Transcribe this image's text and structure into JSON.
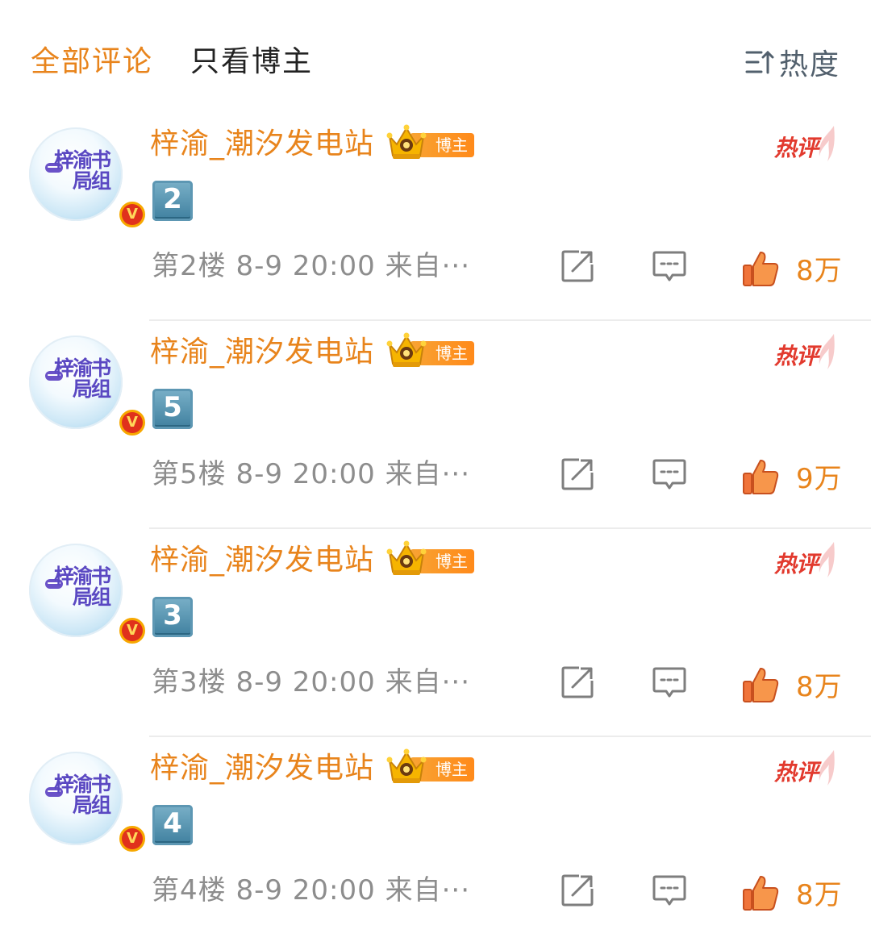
{
  "tabs": {
    "all": "全部评论",
    "blogger_only": "只看博主",
    "sort_label": "热度"
  },
  "badges": {
    "blogger": "博主",
    "hot": "热评",
    "verified": "V"
  },
  "avatar_text": "梓渝书局组",
  "comments": [
    {
      "username": "梓渝_潮汐发电站",
      "keycap": "2",
      "floor": "第2楼",
      "time": "8-9 20:00",
      "source": "来自···",
      "likes": "8万"
    },
    {
      "username": "梓渝_潮汐发电站",
      "keycap": "5",
      "floor": "第5楼",
      "time": "8-9 20:00",
      "source": "来自···",
      "likes": "9万"
    },
    {
      "username": "梓渝_潮汐发电站",
      "keycap": "3",
      "floor": "第3楼",
      "time": "8-9 20:00",
      "source": "来自···",
      "likes": "8万"
    },
    {
      "username": "梓渝_潮汐发电站",
      "keycap": "4",
      "floor": "第4楼",
      "time": "8-9 20:00",
      "source": "来自···",
      "likes": "8万"
    }
  ],
  "icons": {
    "sort": "sort-icon",
    "crown": "crown-icon",
    "share": "share-icon",
    "reply": "comment-icon",
    "like": "thumbs-up-icon"
  },
  "colors": {
    "accent": "#e8841c",
    "hot": "#e23a2e",
    "meta": "#8d8d8d",
    "keycap": "#3e7f9e",
    "verified": "#e0311c"
  }
}
